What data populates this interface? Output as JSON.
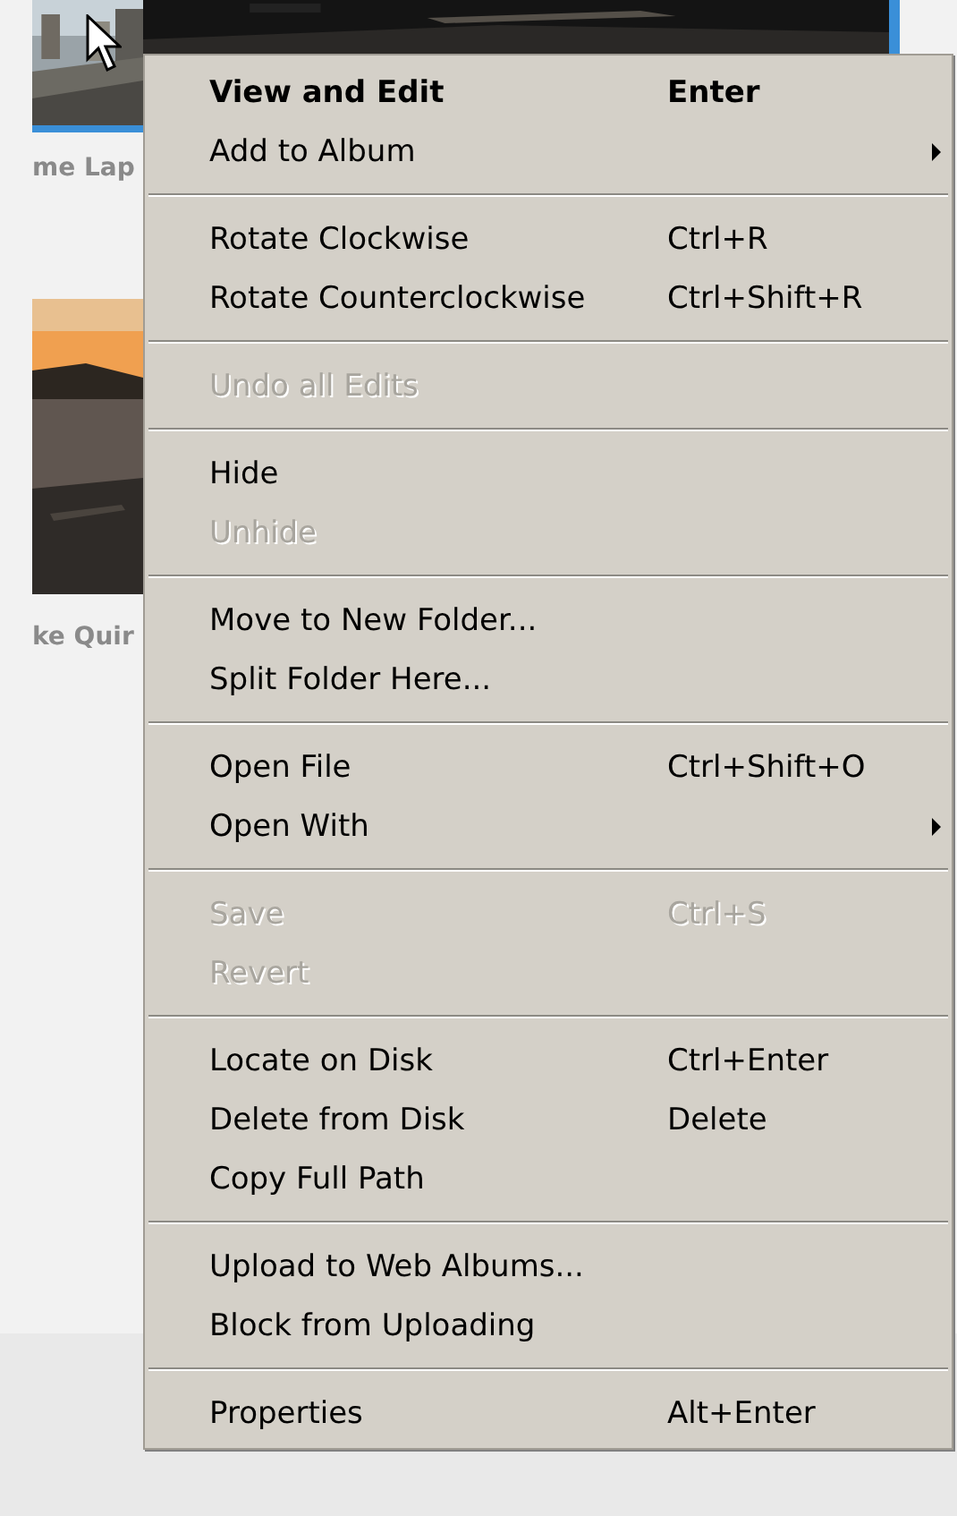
{
  "thumbnails": [
    {
      "kind": "picture",
      "caption": "me Lap",
      "selected": true
    },
    {
      "kind": "picture",
      "caption": "ke Quir",
      "selected": false
    }
  ],
  "top_thumbnail": {
    "kind": "picture",
    "selected": true
  },
  "context_menu": {
    "groups": [
      [
        {
          "label": "View and Edit",
          "shortcut": "Enter",
          "default": true,
          "disabled": false,
          "submenu": false
        },
        {
          "label": "Add to Album",
          "default": false,
          "disabled": false,
          "submenu": true
        }
      ],
      [
        {
          "label": "Rotate Clockwise",
          "shortcut": "Ctrl+R",
          "default": false,
          "disabled": false,
          "submenu": false
        },
        {
          "label": "Rotate Counterclockwise",
          "shortcut": "Ctrl+Shift+R",
          "default": false,
          "disabled": false,
          "submenu": false
        }
      ],
      [
        {
          "label": "Undo all Edits",
          "default": false,
          "disabled": true,
          "submenu": false
        }
      ],
      [
        {
          "label": "Hide",
          "default": false,
          "disabled": false,
          "submenu": false
        },
        {
          "label": "Unhide",
          "default": false,
          "disabled": true,
          "submenu": false
        }
      ],
      [
        {
          "label": "Move to New Folder...",
          "default": false,
          "disabled": false,
          "submenu": false
        },
        {
          "label": "Split Folder Here...",
          "default": false,
          "disabled": false,
          "submenu": false
        }
      ],
      [
        {
          "label": "Open File",
          "shortcut": "Ctrl+Shift+O",
          "default": false,
          "disabled": false,
          "submenu": false
        },
        {
          "label": "Open With",
          "default": false,
          "disabled": false,
          "submenu": true
        }
      ],
      [
        {
          "label": "Save",
          "shortcut": "Ctrl+S",
          "default": false,
          "disabled": true,
          "submenu": false
        },
        {
          "label": "Revert",
          "default": false,
          "disabled": true,
          "submenu": false
        }
      ],
      [
        {
          "label": "Locate on Disk",
          "shortcut": "Ctrl+Enter",
          "default": false,
          "disabled": false,
          "submenu": false
        },
        {
          "label": "Delete from Disk",
          "shortcut": "Delete",
          "default": false,
          "disabled": false,
          "submenu": false
        },
        {
          "label": "Copy Full Path",
          "default": false,
          "disabled": false,
          "submenu": false
        }
      ],
      [
        {
          "label": "Upload to Web Albums...",
          "default": false,
          "disabled": false,
          "submenu": false
        },
        {
          "label": "Block from Uploading",
          "default": false,
          "disabled": false,
          "submenu": false
        }
      ],
      [
        {
          "label": "Properties",
          "shortcut": "Alt+Enter",
          "default": false,
          "disabled": false,
          "submenu": false
        }
      ]
    ]
  }
}
